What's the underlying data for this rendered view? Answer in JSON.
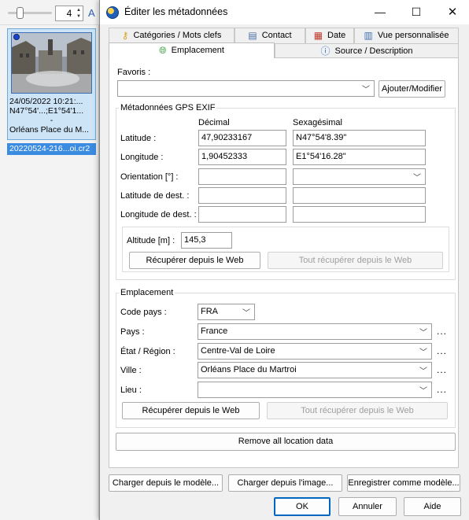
{
  "browser": {
    "zoom_value": "4",
    "thumb": {
      "date": "24/05/2022 10:21:...",
      "coords": "N47°54'...;E1°54'1...",
      "separator": "-",
      "place": "Orléans Place du M...",
      "filename": "20220524-216...oi.cr2"
    }
  },
  "dialog": {
    "title": "Éditer les métadonnées",
    "window_controls": {
      "minimize": "—",
      "maximize": "☐",
      "close": "✕"
    },
    "tabs_row1": [
      {
        "label": "Catégories / Mots clefs",
        "icon": "key-icon"
      },
      {
        "label": "Contact",
        "icon": "contact-card-icon"
      },
      {
        "label": "Date",
        "icon": "calendar-icon"
      },
      {
        "label": "Vue personnalisée",
        "icon": "table-icon"
      }
    ],
    "tabs_row2": [
      {
        "label": "Emplacement",
        "icon": "globe-icon",
        "active": true
      },
      {
        "label": "Source / Description",
        "icon": "info-icon"
      }
    ],
    "favoris": {
      "label": "Favoris :",
      "value": "",
      "button": "Ajouter/Modifier"
    },
    "gps": {
      "group_title": "Métadonnées GPS EXIF",
      "col_decimal": "Décimal",
      "col_sexa": "Sexagésimal",
      "latitude": {
        "label": "Latitude :",
        "decimal": "47,90233167",
        "sexa": "N47°54'8.39\""
      },
      "longitude": {
        "label": "Longitude :",
        "decimal": "1,90452333",
        "sexa": "E1°54'16.28\""
      },
      "orientation": {
        "label": "Orientation [°] :",
        "decimal": "",
        "sexa": ""
      },
      "dest_lat": {
        "label": "Latitude de dest. :",
        "decimal": "",
        "sexa": ""
      },
      "dest_lon": {
        "label": "Longitude de dest. :",
        "decimal": "",
        "sexa": ""
      },
      "altitude": {
        "label": "Altitude [m] :",
        "value": "145,3"
      },
      "btn_fetch": "Récupérer depuis le Web",
      "btn_fetch_all": "Tout récupérer depuis le Web"
    },
    "location": {
      "group_title": "Emplacement",
      "country_code": {
        "label": "Code pays :",
        "value": "FRA"
      },
      "country": {
        "label": "Pays :",
        "value": "France"
      },
      "state": {
        "label": "État / Région :",
        "value": "Centre-Val de Loire"
      },
      "city": {
        "label": "Ville :",
        "value": "Orléans Place du Martroi"
      },
      "place": {
        "label": "Lieu :",
        "value": ""
      },
      "more": "...",
      "btn_fetch": "Récupérer depuis le Web",
      "btn_fetch_all": "Tout récupérer depuis le Web"
    },
    "remove_all": "Remove all location data",
    "template_buttons": {
      "load_template": "Charger depuis le modèle...",
      "load_image": "Charger depuis l'image...",
      "save_template": "Enregistrer comme modèle..."
    },
    "footer": {
      "ok": "OK",
      "cancel": "Annuler",
      "help": "Aide"
    }
  }
}
